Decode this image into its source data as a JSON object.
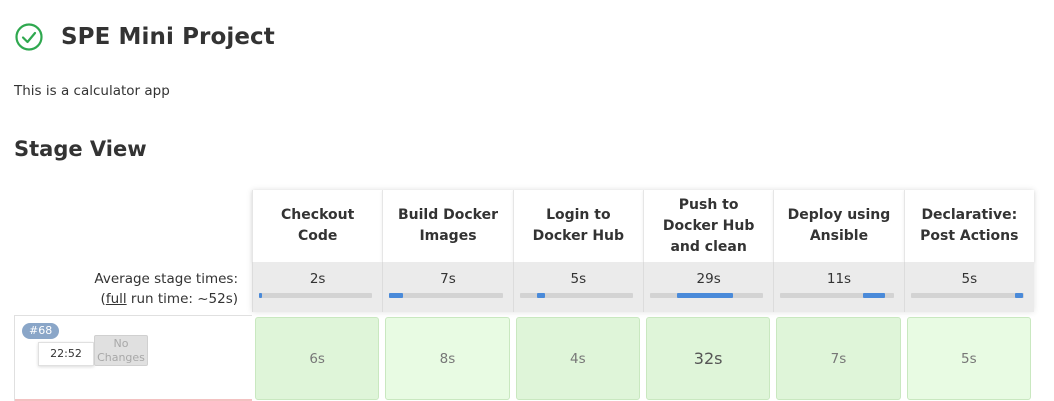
{
  "project": {
    "title": "SPE Mini Project",
    "description": "This is a calculator app",
    "status_icon": "success-check-icon",
    "status_color": "#2fa84f"
  },
  "stage_view": {
    "title": "Stage View",
    "avg_label_line1": "Average stage times:",
    "avg_label_full": "full",
    "avg_label_rest": " run time: ~52s)",
    "avg_label_open": "(",
    "stages": [
      {
        "name": "Checkout Code",
        "avg": "2s",
        "bar_start": 0.0,
        "bar_fraction": 0.03
      },
      {
        "name": "Build Docker Images",
        "avg": "7s",
        "bar_start": 0.0,
        "bar_fraction": 0.12
      },
      {
        "name": "Login to Docker Hub",
        "avg": "5s",
        "bar_start": 0.15,
        "bar_fraction": 0.07
      },
      {
        "name": "Push to Docker Hub and clean",
        "avg": "29s",
        "bar_start": 0.24,
        "bar_fraction": 0.49
      },
      {
        "name": "Deploy using Ansible",
        "avg": "11s",
        "bar_start": 0.73,
        "bar_fraction": 0.19
      },
      {
        "name": "Declarative: Post Actions",
        "avg": "5s",
        "bar_start": 0.92,
        "bar_fraction": 0.07
      }
    ],
    "accent_color": "#4a8ad9",
    "success_cell_color": "#dff5d9"
  },
  "build": {
    "number": "#68",
    "time": "22:52",
    "changes_line1": "No",
    "changes_line2": "Changes",
    "results": [
      "6s",
      "8s",
      "4s",
      "32s",
      "7s",
      "5s"
    ]
  }
}
